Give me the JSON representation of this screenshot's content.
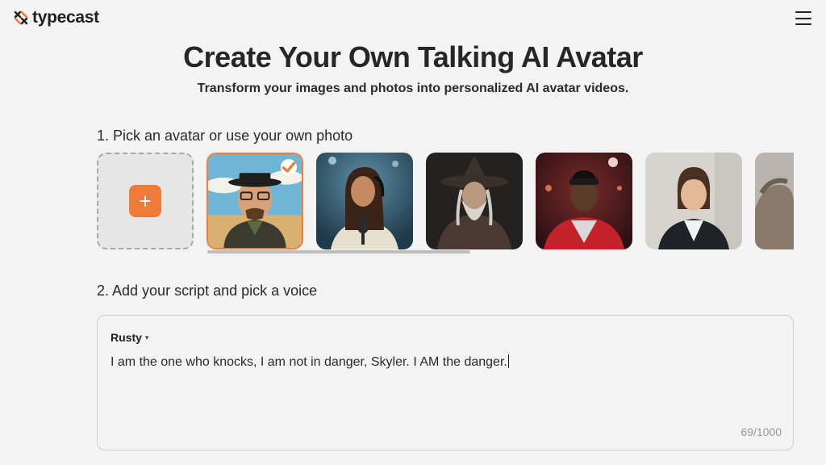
{
  "brand": {
    "name": "typecast",
    "accent": "#ef7a3a"
  },
  "header": {
    "menu_icon": "hamburger-icon"
  },
  "hero": {
    "title": "Create Your Own Talking AI Avatar",
    "subtitle": "Transform your images and photos into personalized AI avatar videos."
  },
  "step1": {
    "title": "1. Pick an avatar or use your own photo",
    "upload_icon": "plus-icon",
    "avatars": [
      {
        "name": "bald-man-with-glasses-hat",
        "selected": true
      },
      {
        "name": "woman-with-microphone",
        "selected": false
      },
      {
        "name": "wizard",
        "selected": false
      },
      {
        "name": "man-in-red-hoodie",
        "selected": false
      },
      {
        "name": "business-woman",
        "selected": false
      },
      {
        "name": "partial-avatar",
        "selected": false
      }
    ]
  },
  "step2": {
    "title": "2. Add your script and pick a voice",
    "voice": "Rusty",
    "script": "I am the one who knocks, I am not in danger, Skyler. I AM the danger.",
    "counter": "69/1000"
  }
}
